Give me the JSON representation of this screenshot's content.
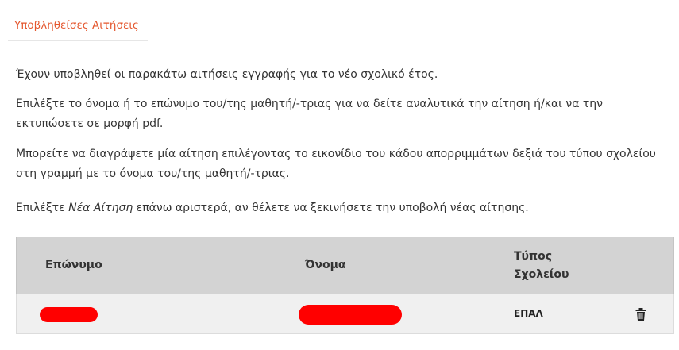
{
  "tab": {
    "label": "Υποβληθείσες Αιτήσεις"
  },
  "intro": {
    "p1": "Έχουν υποβληθεί οι παρακάτω αιτήσεις εγγραφής για το νέο σχολικό έτος.",
    "p2": "Επιλέξτε το όνομα ή το επώνυμο του/της μαθητή/-τριας για να δείτε αναλυτικά την αίτηση ή/και να την εκτυπώσετε σε μορφή pdf.",
    "p3": "Μπορείτε να διαγράψετε μία αίτηση επιλέγοντας το εικονίδιο του κάδου απορριμμάτων δεξιά του τύπου σχολείου στη γραμμή με το όνομα του/της μαθητή/-τριας.",
    "p4_before": "Επιλέξτε ",
    "p4_emphasis": "Νέα Αίτηση",
    "p4_after": " επάνω αριστερά, αν θέλετε να ξεκινήσετε την υποβολή νέας αίτησης."
  },
  "table": {
    "headers": {
      "lastname": "Επώνυμο",
      "firstname": "Όνομα",
      "school_type_line1": "Τύπος",
      "school_type_line2": "Σχολείου"
    },
    "rows": [
      {
        "lastname_redacted": true,
        "firstname_redacted": true,
        "school_type": "ΕΠΑΛ",
        "action_icon": "trash-icon"
      }
    ]
  },
  "colors": {
    "tab_text": "#e4572e",
    "header_bg": "#d3d3d3",
    "row_bg": "#f0f0f0",
    "redaction": "#ff0000"
  }
}
